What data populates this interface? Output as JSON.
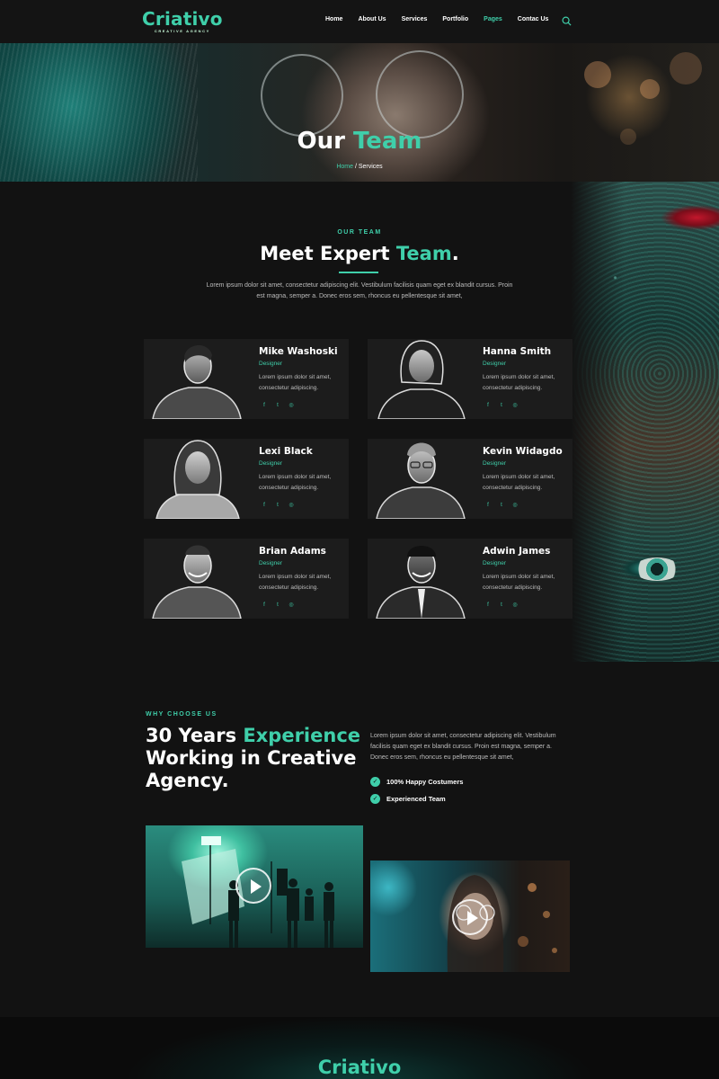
{
  "brand": {
    "name": "Criativo",
    "tagline": "CREATIVE AGENCY"
  },
  "nav": {
    "items": [
      {
        "label": "Home"
      },
      {
        "label": "About Us"
      },
      {
        "label": "Services"
      },
      {
        "label": "Portfolio"
      },
      {
        "label": "Pages"
      },
      {
        "label": "Contac Us"
      }
    ],
    "active": "Pages",
    "search_icon": "search-icon"
  },
  "hero": {
    "title_plain": "Our",
    "title_accent": "Team",
    "breadcrumb_home": "Home",
    "breadcrumb_sep": " / ",
    "breadcrumb_current": "Services"
  },
  "team": {
    "kicker": "OUR TEAM",
    "title_plain": "Meet Expert",
    "title_accent": "Team",
    "title_end": ".",
    "description": "Lorem ipsum dolor sit amet, consectetur adipiscing elit. Vestibulum facilisis quam eget ex blandit cursus. Proin est magna, semper a. Donec eros sem, rhoncus eu pellentesque sit amet,",
    "members": [
      {
        "name": "Mike Washoski",
        "role": "Designer",
        "bio": "Lorem ipsum dolor sit amet, consectetur adipiscing."
      },
      {
        "name": "Hanna Smith",
        "role": "Designer",
        "bio": "Lorem ipsum dolor sit amet, consectetur adipiscing."
      },
      {
        "name": "Lexi Black",
        "role": "Designer",
        "bio": "Lorem ipsum dolor sit amet, consectetur adipiscing."
      },
      {
        "name": "Kevin Widagdo",
        "role": "Designer",
        "bio": "Lorem ipsum dolor sit amet, consectetur adipiscing."
      },
      {
        "name": "Brian Adams",
        "role": "Designer",
        "bio": "Lorem ipsum dolor sit amet, consectetur adipiscing."
      },
      {
        "name": "Adwin James",
        "role": "Designer",
        "bio": "Lorem ipsum dolor sit amet, consectetur adipiscing."
      }
    ],
    "social_icons": [
      "facebook-icon",
      "twitter-icon",
      "instagram-icon"
    ]
  },
  "why": {
    "kicker": "WHY CHOOSE US",
    "title_line1_plain": "30 Years",
    "title_line1_accent": "Experience",
    "title_line2": "Working in Creative",
    "title_line3": "Agency.",
    "description": "Lorem ipsum dolor sit amet, consectetur adipiscing elit. Vestibulum facilisis quam eget ex blandit cursus. Proin est magna, semper a. Donec eros sem, rhoncus eu pellentesque sit amet,",
    "checks": [
      {
        "label": "100% Happy Costumers"
      },
      {
        "label": "Experienced Team"
      }
    ]
  },
  "footer": {
    "brand": "Criativo"
  },
  "colors": {
    "accent": "#3fcfaa",
    "background": "#121212",
    "card": "#1c1c1c"
  }
}
